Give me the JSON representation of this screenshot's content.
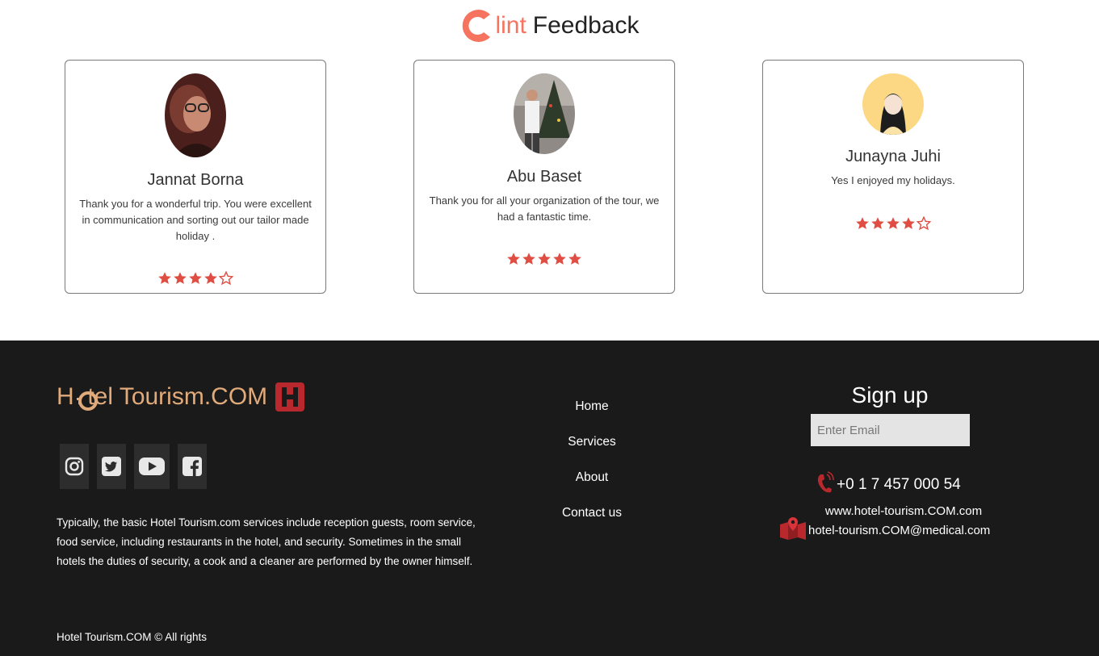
{
  "feedback": {
    "title_accent": "lint",
    "title_rest": "Feedback",
    "cards": [
      {
        "name": "Jannat Borna",
        "text": "Thank you for a wonderful trip. You were excellent in communication and sorting out our tailor made holiday .",
        "rating": 4,
        "max_rating": 5
      },
      {
        "name": "Abu Baset",
        "text": "Thank you for all your organization of the tour, we had a fantastic time.",
        "rating": 5,
        "max_rating": 5
      },
      {
        "name": "Junayna Juhi",
        "text": "Yes I enjoyed my holidays.",
        "rating": 4,
        "max_rating": 5
      }
    ]
  },
  "footer": {
    "brand": "H  tel Tourism.COM",
    "socials": [
      "instagram-icon",
      "twitter-icon",
      "youtube-icon",
      "facebook-icon"
    ],
    "description": "Typically, the basic Hotel Tourism.com services include reception guests, room service, food service, including restaurants in the hotel, and security. Sometimes in the small hotels the duties of security, a cook and a cleaner are performed by the owner himself.",
    "copyright": "Hotel Tourism.COM © All rights",
    "nav": [
      "Home",
      "Services",
      "About",
      "Contact us"
    ],
    "signup_title": "Sign up",
    "email_placeholder": "Enter Email",
    "phone": "+0 1 7 457 000 54",
    "website": "www.hotel-tourism.COM.com",
    "email": "hotel-tourism.COM@medical.com"
  },
  "colors": {
    "accent": "#f5735f",
    "star": "#e04e43",
    "footer_bg": "#1b1a1a",
    "brand": "#e0aa7b",
    "brand_badge": "#b8282c"
  }
}
